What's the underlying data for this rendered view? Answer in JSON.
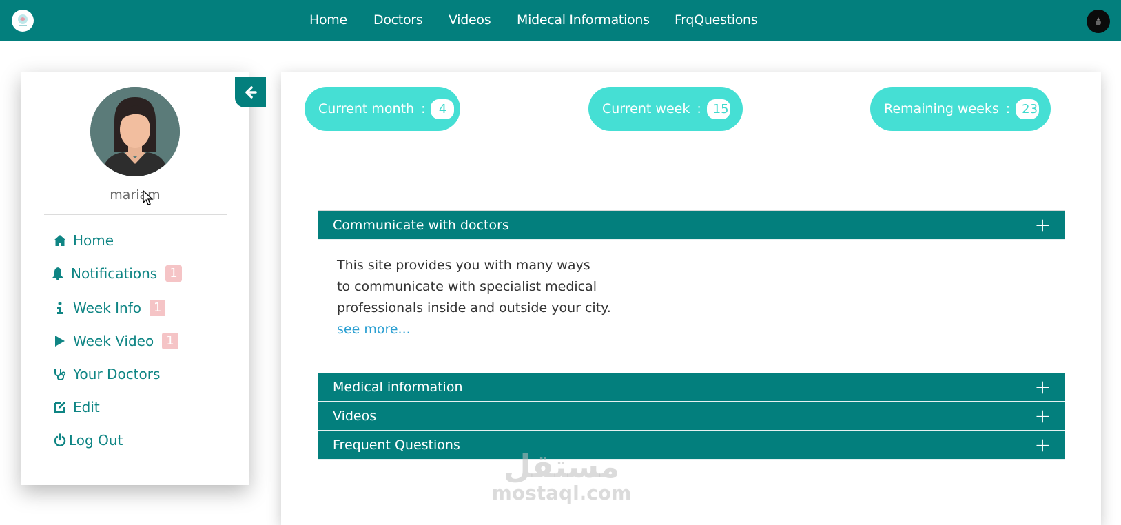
{
  "navbar": {
    "links": [
      "Home",
      "Doctors",
      "Videos",
      "Midecal Informations",
      "FrqQuestions"
    ],
    "bg_color": "#037f7d"
  },
  "sidebar": {
    "username": "mariam",
    "items": [
      {
        "label": "Home",
        "icon": "home-icon"
      },
      {
        "label": "Notifications",
        "icon": "bell-icon",
        "badge": "1"
      },
      {
        "label": "Week Info",
        "icon": "info-icon",
        "badge": "1"
      },
      {
        "label": "Week Video",
        "icon": "play-icon",
        "badge": "1"
      },
      {
        "label": "Your Doctors",
        "icon": "stethoscope-icon"
      },
      {
        "label": "Edit",
        "icon": "edit-icon"
      },
      {
        "label": "Log Out",
        "icon": "power-icon"
      }
    ]
  },
  "stats": {
    "current_month": {
      "label": "Current month",
      "sep": ":",
      "value": "4"
    },
    "current_week": {
      "label": "Current week",
      "sep": ":",
      "value": "15"
    },
    "remaining_weeks": {
      "label": "Remaining weeks",
      "sep": ":",
      "value": "23"
    }
  },
  "accordion": {
    "sections": [
      {
        "title": "Communicate with doctors",
        "expanded": true,
        "body_lines": [
          "This site provides you with many ways",
          "to communicate with specialist medical",
          "professionals inside and outside your city."
        ],
        "more_link": "see more..."
      },
      {
        "title": "Medical information",
        "expanded": false
      },
      {
        "title": "Videos",
        "expanded": false
      },
      {
        "title": "Frequent Questions",
        "expanded": false
      }
    ]
  },
  "watermark": {
    "arabic": "مستقل",
    "latin": "mostaql.com"
  },
  "colors": {
    "teal": "#037f7d",
    "pill": "#45dfd4",
    "link": "#2a9fd2",
    "badge": "#f5c4c6"
  }
}
